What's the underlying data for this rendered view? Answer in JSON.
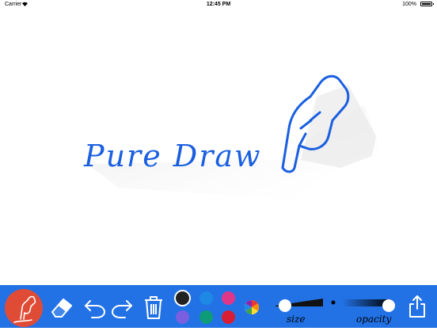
{
  "status_bar": {
    "carrier": "Carrier",
    "time": "12:45 PM",
    "battery": "100%"
  },
  "canvas": {
    "drawing_text": "Pure Draw",
    "ink_color": "#1a5fe0"
  },
  "toolbar": {
    "background": "#2272e6",
    "pen_bg": "#e04b35",
    "tools": [
      "pen-icon",
      "eraser-icon",
      "undo-icon",
      "redo-icon",
      "trash-icon"
    ],
    "colors": [
      {
        "name": "black",
        "hex": "#222222",
        "selected": true
      },
      {
        "name": "blue",
        "hex": "#1e88e5",
        "selected": false
      },
      {
        "name": "pink",
        "hex": "#e0368a",
        "selected": false
      },
      {
        "name": "purple",
        "hex": "#7a5fe0",
        "selected": false
      },
      {
        "name": "green",
        "hex": "#0e9b78",
        "selected": false
      },
      {
        "name": "red",
        "hex": "#d81e34",
        "selected": false
      }
    ],
    "size_label": "size",
    "opacity_label": "opacity",
    "share_icon": "share-icon"
  }
}
